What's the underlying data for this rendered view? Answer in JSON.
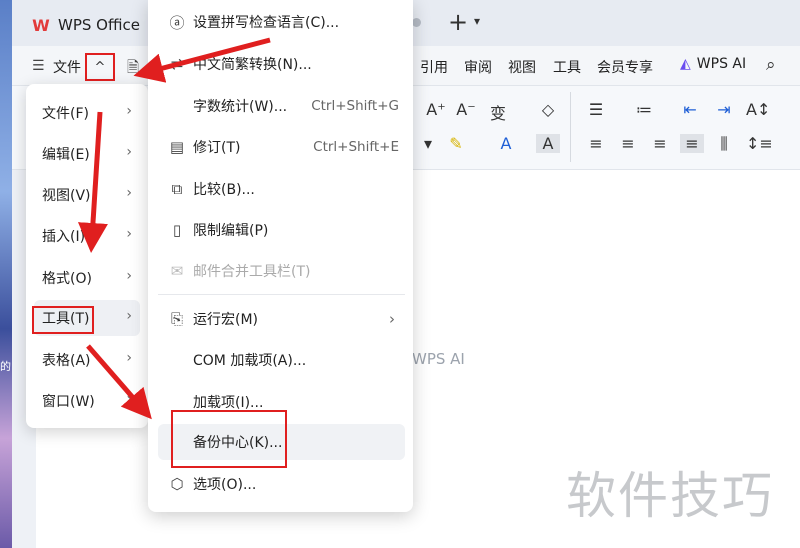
{
  "window": {
    "app_tab_label": "WPS Office",
    "new_tab": "+",
    "tab_dropdown": "⌄"
  },
  "menubar": {
    "file_label": "文件",
    "caret": "^",
    "menus": [
      "引用",
      "审阅",
      "视图",
      "工具",
      "会员专享"
    ],
    "wps_ai_label": "WPS AI"
  },
  "document": {
    "ai_hint": "WPS AI",
    "watermark": "软件技巧"
  },
  "file_menu": {
    "items": [
      {
        "label": "文件(F)"
      },
      {
        "label": "编辑(E)"
      },
      {
        "label": "视图(V)"
      },
      {
        "label": "插入(I)"
      },
      {
        "label": "格式(O)"
      },
      {
        "label": "工具(T)"
      },
      {
        "label": "表格(A)"
      },
      {
        "label": "窗口(W)"
      }
    ],
    "active_index": 5
  },
  "tools_submenu": {
    "items": [
      {
        "icon": "spellcheck-language-icon",
        "label": "设置拼写检查语言(C)...",
        "shortcut": ""
      },
      {
        "icon": "chinese-convert-icon",
        "label": "中文简繁转换(N)...",
        "shortcut": ""
      },
      {
        "icon": "",
        "label": "字数统计(W)...",
        "shortcut": "Ctrl+Shift+G"
      },
      {
        "icon": "track-changes-icon",
        "label": "修订(T)",
        "shortcut": "Ctrl+Shift+E"
      },
      {
        "icon": "compare-icon",
        "label": "比较(B)...",
        "shortcut": ""
      },
      {
        "icon": "restrict-edit-icon",
        "label": "限制编辑(P)",
        "shortcut": ""
      },
      {
        "icon": "mail-merge-icon",
        "label": "邮件合并工具栏(T)",
        "shortcut": ""
      },
      {
        "icon": "macro-icon",
        "label": "运行宏(M)",
        "shortcut": ""
      },
      {
        "icon": "",
        "label": "COM 加载项(A)...",
        "shortcut": ""
      },
      {
        "icon": "",
        "label": "加载项(I)...",
        "shortcut": ""
      },
      {
        "icon": "",
        "label": "备份中心(K)...",
        "shortcut": ""
      },
      {
        "icon": "options-icon",
        "label": "选项(O)...",
        "shortcut": ""
      }
    ]
  },
  "colors": {
    "annotation_red": "#e01f1f",
    "wps_red": "#e23b3b",
    "ai_purple": "#6a4cf0"
  }
}
